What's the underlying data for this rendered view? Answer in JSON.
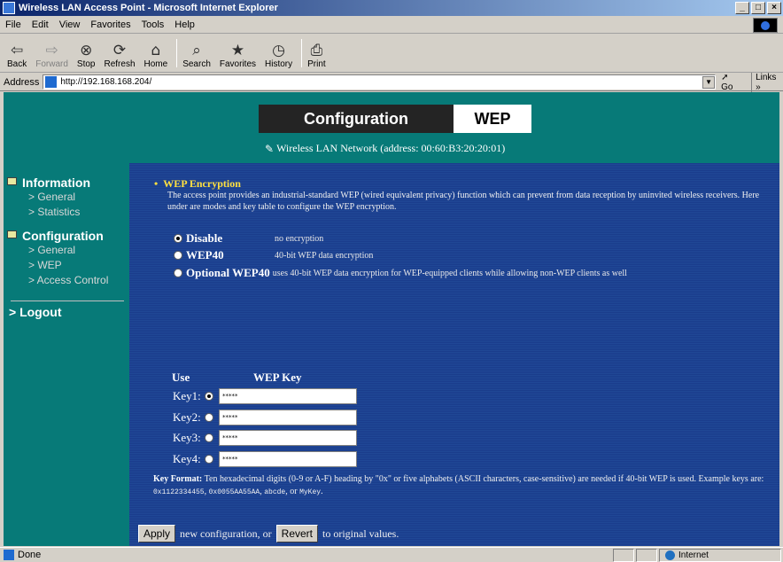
{
  "window": {
    "title": "Wireless LAN Access Point - Microsoft Internet Explorer",
    "controls": [
      "_",
      "□",
      "×"
    ]
  },
  "menu": [
    "File",
    "Edit",
    "View",
    "Favorites",
    "Tools",
    "Help"
  ],
  "toolbar": [
    {
      "label": "Back",
      "icon": "back-arrow-icon",
      "glyph": "⇦",
      "enabled": true
    },
    {
      "label": "Forward",
      "icon": "forward-arrow-icon",
      "glyph": "⇨",
      "enabled": false
    },
    {
      "label": "Stop",
      "icon": "stop-icon",
      "glyph": "⊗",
      "enabled": true
    },
    {
      "label": "Refresh",
      "icon": "refresh-icon",
      "glyph": "⟳",
      "enabled": true
    },
    {
      "label": "Home",
      "icon": "home-icon",
      "glyph": "⌂",
      "enabled": true
    },
    {
      "label": "Search",
      "icon": "search-icon",
      "glyph": "⌕",
      "enabled": true
    },
    {
      "label": "Favorites",
      "icon": "favorites-icon",
      "glyph": "★",
      "enabled": true
    },
    {
      "label": "History",
      "icon": "history-icon",
      "glyph": "◷",
      "enabled": true
    },
    {
      "label": "Print",
      "icon": "print-icon",
      "glyph": "⎙",
      "enabled": true
    }
  ],
  "address": {
    "label": "Address",
    "url": "http://192.168.168.204/",
    "go": "Go",
    "links": "Links »"
  },
  "header": {
    "section": "Configuration",
    "page": "WEP",
    "network": "Wireless LAN Network (address: 00:60:B3:20:20:01)"
  },
  "sidebar": {
    "information": {
      "label": "Information",
      "items": [
        "> General",
        "> Statistics"
      ]
    },
    "configuration": {
      "label": "Configuration",
      "items": [
        "> General",
        "> WEP",
        "> Access Control"
      ]
    },
    "logout": "> Logout"
  },
  "wep": {
    "title": "WEP Encryption",
    "description": "The access point provides an industrial-standard WEP (wired equivalent privacy) function which can prevent from data reception by uninvited wireless receivers. Here under are modes and key table to configure the WEP encryption.",
    "modes": [
      {
        "name": "Disable",
        "desc": "no encryption",
        "selected": true
      },
      {
        "name": "WEP40",
        "desc": "40-bit WEP data encryption",
        "selected": false
      },
      {
        "name": "Optional WEP40",
        "desc": "uses 40-bit WEP data encryption for WEP-equipped clients while allowing non-WEP clients as well",
        "selected": false
      }
    ],
    "col_use": "Use",
    "col_key": "WEP Key",
    "keys": [
      {
        "label": "Key1:",
        "value": "*****",
        "selected": true
      },
      {
        "label": "Key2:",
        "value": "*****",
        "selected": false
      },
      {
        "label": "Key3:",
        "value": "*****",
        "selected": false
      },
      {
        "label": "Key4:",
        "value": "*****",
        "selected": false
      }
    ],
    "format_label": "Key Format:",
    "format_text": "Ten hexadecimal digits (0-9 or A-F) heading by \"0x\" or five alphabets (ASCII characters, case-sensitive) are needed if 40-bit WEP is used. Example keys are:",
    "example_1": "0x1122334455",
    "example_2": "0x0055AA55AA",
    "example_3": "abcde",
    "example_4": "MyKey",
    "sep_comma": ",",
    "sep_or": ", or",
    "period": "."
  },
  "actions": {
    "apply": "Apply",
    "middle": "new configuration, or",
    "revert": "Revert",
    "tail": "to original values."
  },
  "status": {
    "text": "Done",
    "zone": "Internet"
  }
}
